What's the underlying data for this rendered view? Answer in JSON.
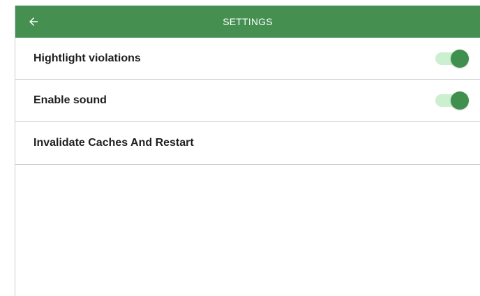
{
  "header": {
    "title": "SETTINGS",
    "back_icon": "arrow-left-icon",
    "background": "#458f51",
    "text_color": "#ffffff"
  },
  "settings": [
    {
      "label": "Hightlight violations",
      "type": "toggle",
      "enabled": true,
      "track_color": "#ccefd0",
      "thumb_color": "#3f8f4e"
    },
    {
      "label": "Enable sound",
      "type": "toggle",
      "enabled": true,
      "track_color": "#ccefd0",
      "thumb_color": "#3f8f4e"
    },
    {
      "label": "Invalidate Caches And Restart",
      "type": "action"
    }
  ]
}
